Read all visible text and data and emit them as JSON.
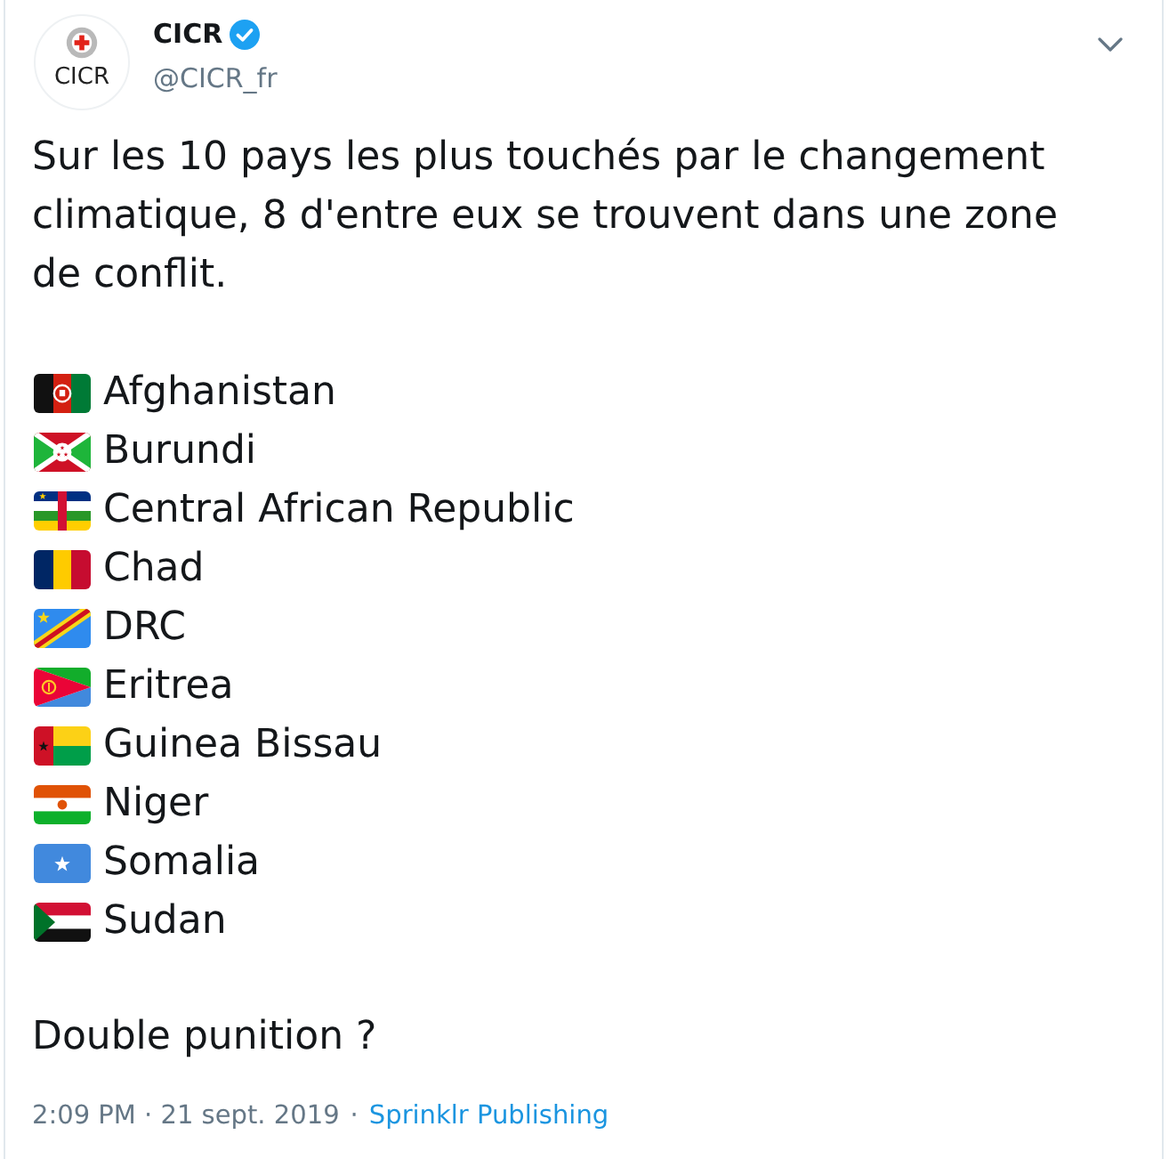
{
  "tweet": {
    "author": {
      "name": "CICR",
      "handle": "@CICR_fr",
      "verified": true,
      "avatar_caption": "CICR"
    },
    "text": "Sur les 10 pays les plus touchés par le changement climatique, 8 d'entre eux se trouvent dans une zone de conflit.",
    "countries": [
      {
        "kind": "af",
        "name": "Afghanistan"
      },
      {
        "kind": "bi",
        "name": "Burundi"
      },
      {
        "kind": "cf",
        "name": "Central African Republic"
      },
      {
        "kind": "td",
        "name": "Chad"
      },
      {
        "kind": "cd",
        "name": "DRC"
      },
      {
        "kind": "er",
        "name": "Eritrea"
      },
      {
        "kind": "gw",
        "name": "Guinea Bissau"
      },
      {
        "kind": "ne",
        "name": "Niger"
      },
      {
        "kind": "so",
        "name": "Somalia"
      },
      {
        "kind": "sd",
        "name": "Sudan"
      }
    ],
    "closing": "Double punition ?",
    "footer": {
      "timestamp": "2:09 PM · 21 sept. 2019",
      "separator": "·",
      "source": "Sprinklr Publishing"
    }
  }
}
